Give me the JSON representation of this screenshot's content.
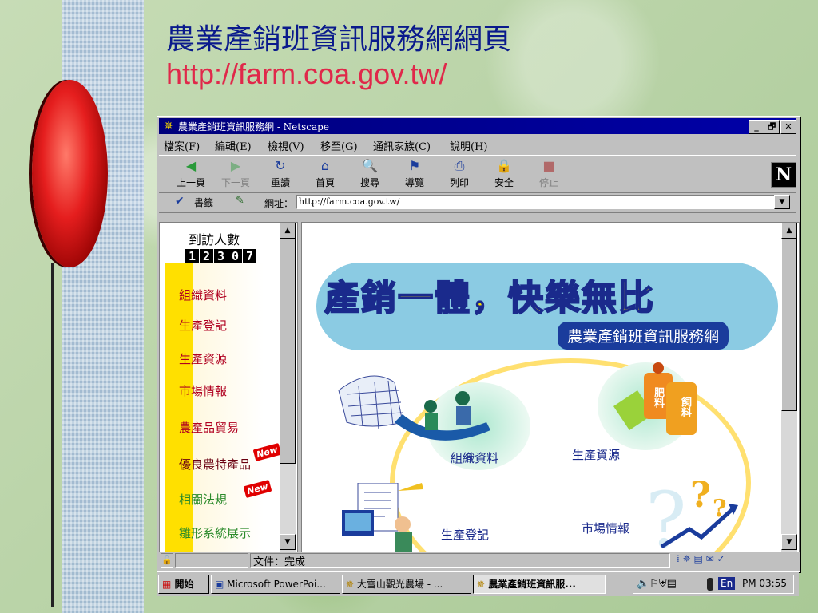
{
  "slide": {
    "title": "農業產銷班資訊服務網網頁",
    "url": "http://farm.coa.gov.tw/"
  },
  "window": {
    "title": "農業產銷班資訊服務網 - Netscape",
    "minimize": "_",
    "maximize": "🗗",
    "close": "✕"
  },
  "menu": [
    "檔案(F)",
    "編輯(E)",
    "檢視(V)",
    "移至(G)",
    "通訊家族(C)",
    "說明(H)"
  ],
  "toolbar": [
    {
      "label": "上一頁",
      "icon": "back-icon",
      "glyph": "◀"
    },
    {
      "label": "下一頁",
      "icon": "forward-icon",
      "glyph": "▶"
    },
    {
      "label": "重讀",
      "icon": "reload-icon",
      "glyph": "↻"
    },
    {
      "label": "首頁",
      "icon": "home-icon",
      "glyph": "⌂"
    },
    {
      "label": "搜尋",
      "icon": "search-icon",
      "glyph": "🔍"
    },
    {
      "label": "導覽",
      "icon": "guide-icon",
      "glyph": "⚑"
    },
    {
      "label": "列印",
      "icon": "print-icon",
      "glyph": "⎙"
    },
    {
      "label": "安全",
      "icon": "lock-icon",
      "glyph": "🔒"
    },
    {
      "label": "停止",
      "icon": "stop-icon",
      "glyph": "■"
    }
  ],
  "netscape_logo": "N",
  "location": {
    "bookmarks": "書籤",
    "address_label": "網址：",
    "address_value": "http://farm.coa.gov.tw/"
  },
  "left_frame": {
    "counter_label": "到訪人數",
    "counter_digits": [
      "1",
      "2",
      "3",
      "0",
      "7"
    ],
    "links": [
      "組織資料",
      "生產登記",
      "生產資源",
      "市場情報",
      "農產品貿易",
      "優良農特產品",
      "相關法規",
      "雛形系統展示"
    ],
    "new_badge": "New"
  },
  "main_frame": {
    "banner": "產銷一體，快樂無比",
    "subtitle": "農業產銷班資訊服務網",
    "labels": [
      "組織資料",
      "生產資源",
      "生產登記",
      "市場情報"
    ],
    "bag_labels": [
      "肥料",
      "飼料"
    ]
  },
  "status": {
    "text": "文件：完成"
  },
  "taskbar": {
    "start": "開始",
    "tasks": [
      "Microsoft PowerPoi...",
      "大雪山觀光農場 - ...",
      "農業產銷班資訊服..."
    ],
    "lang": "En",
    "clock": "PM 03:55"
  },
  "colors": {
    "title_blue": "#0a1a8c",
    "url_red": "#e0284a",
    "titlebar": "#00007c",
    "link_red": "#b00020"
  }
}
